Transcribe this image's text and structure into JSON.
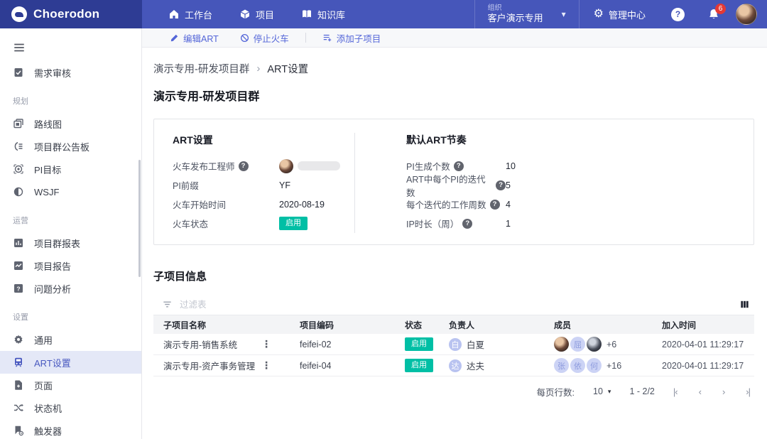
{
  "topbar": {
    "logo_text": "Choerodon",
    "nav": [
      {
        "icon": "home-icon",
        "label": "工作台"
      },
      {
        "icon": "project-cube-icon",
        "label": "项目"
      },
      {
        "icon": "knowledge-book-icon",
        "label": "知识库"
      }
    ],
    "org_switcher": {
      "caption": "组织",
      "value": "客户演示专用"
    },
    "admin_label": "管理中心",
    "notification_count": "6"
  },
  "sidebar": {
    "top_item": {
      "icon": "requirement-review-icon",
      "label": "需求审核"
    },
    "sections": [
      {
        "title": "规划",
        "items": [
          {
            "icon": "roadmap-icon",
            "label": "路线图"
          },
          {
            "icon": "board-icon",
            "label": "项目群公告板"
          },
          {
            "icon": "target-icon",
            "label": "PI目标"
          },
          {
            "icon": "pie-icon",
            "label": "WSJF"
          }
        ]
      },
      {
        "title": "运营",
        "items": [
          {
            "icon": "bar-chart-icon",
            "label": "项目群报表"
          },
          {
            "icon": "line-chart-icon",
            "label": "项目报告"
          },
          {
            "icon": "question-square-icon",
            "label": "问题分析"
          }
        ]
      },
      {
        "title": "设置",
        "items": [
          {
            "icon": "gear-icon",
            "label": "通用"
          },
          {
            "icon": "train-icon",
            "label": "ART设置",
            "active": true
          },
          {
            "icon": "page-icon",
            "label": "页面"
          },
          {
            "icon": "state-machine-icon",
            "label": "状态机"
          },
          {
            "icon": "trigger-icon",
            "label": "触发器"
          }
        ]
      }
    ]
  },
  "toolbar": {
    "buttons": [
      {
        "icon": "pencil-icon",
        "label": "编辑ART"
      },
      {
        "icon": "ban-icon",
        "label": "停止火车"
      },
      {
        "icon": "list-plus-icon",
        "label": "添加子项目"
      }
    ]
  },
  "breadcrumb": {
    "parent": "演示专用-研发项目群",
    "separator": "›",
    "current": "ART设置"
  },
  "page_title": "演示专用-研发项目群",
  "art_card": {
    "left": {
      "title": "ART设置",
      "engineer_label": "火车发布工程师",
      "prefix_label": "PI前缀",
      "prefix_value": "YF",
      "start_label": "火车开始时间",
      "start_value": "2020-08-19",
      "status_label": "火车状态",
      "status_value": "启用"
    },
    "right": {
      "title": "默认ART节奏",
      "rows": [
        {
          "label": "PI生成个数",
          "value": "10"
        },
        {
          "label": "ART中每个PI的迭代数",
          "value": "5"
        },
        {
          "label": "每个迭代的工作周数",
          "value": "4"
        },
        {
          "label": "IP时长（周）",
          "value": "1"
        }
      ]
    }
  },
  "subprojects": {
    "title": "子项目信息",
    "filter_placeholder": "过滤表",
    "columns": [
      "子项目名称",
      "项目编码",
      "状态",
      "负责人",
      "成员",
      "加入时间"
    ],
    "rows": [
      {
        "name": "演示专用-销售系统",
        "code": "feifei-02",
        "status": "启用",
        "owner": {
          "initial": "白",
          "name": "白夏"
        },
        "members": {
          "m2_letter": "屈",
          "more": "+6"
        },
        "joined": "2020-04-01 11:29:17"
      },
      {
        "name": "演示专用-资产事务管理",
        "code": "feifei-04",
        "status": "启用",
        "owner": {
          "initial": "达",
          "name": "达夫"
        },
        "members": {
          "m1_letter": "张",
          "m2_letter": "依",
          "m3_letter": "何",
          "more": "+16"
        },
        "joined": "2020-04-01 11:29:17"
      }
    ],
    "pagination": {
      "rows_per_page_label": "每页行数:",
      "rows_per_page_value": "10",
      "range": "1 - 2/2"
    }
  },
  "glyphs": {
    "kebab": "⋮",
    "chevron_down": "▾",
    "gear": "⚙",
    "question_mark": "?",
    "page_first": "|‹",
    "page_prev": "‹",
    "page_next": "›",
    "page_last": "›|"
  },
  "colors": {
    "topbar": "#4656ba",
    "logo_block": "#2e3c94",
    "accent": "#5365d8",
    "active_item_bg": "#e4e8f7",
    "active_item_text": "#4a5ac0",
    "status_green": "#00bfa5",
    "notification_red": "#e53935"
  }
}
